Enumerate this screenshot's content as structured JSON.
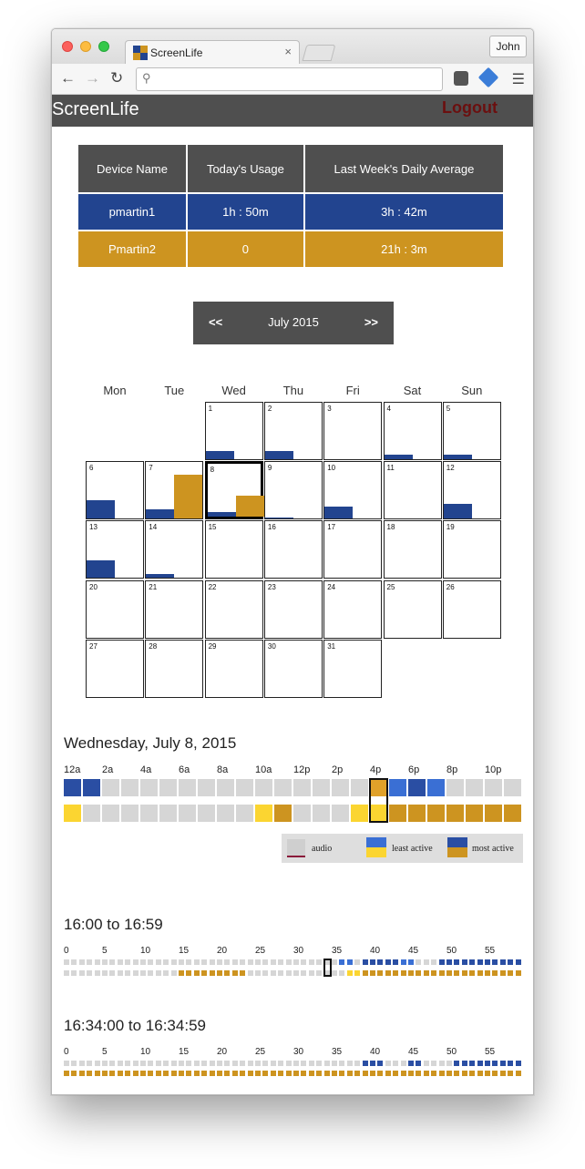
{
  "browser": {
    "tab_title": "ScreenLife",
    "tab_close": "×",
    "profile": "John",
    "address": ""
  },
  "app": {
    "brand": "ScreenLife",
    "logout": "Logout"
  },
  "devices": {
    "headers": [
      "Device Name",
      "Today's Usage",
      "Last Week's Daily Average"
    ],
    "rows": [
      {
        "name": "pmartin1",
        "today": "1h : 50m",
        "avg": "3h : 42m",
        "color": "#22448f"
      },
      {
        "name": "Pmartin2",
        "today": "0",
        "avg": "21h : 3m",
        "color": "#cd9420"
      }
    ]
  },
  "calendar": {
    "prev": "<<",
    "next": ">>",
    "month": "July 2015",
    "weekdays": [
      "Mon",
      "Tue",
      "Wed",
      "Thu",
      "Fri",
      "Sat",
      "Sun"
    ],
    "first_weekday": 2,
    "days_in_month": 31,
    "selected_day": 8,
    "usage": {
      "1": {
        "d1": 0.15,
        "d2": 0
      },
      "2": {
        "d1": 0.14,
        "d2": 0
      },
      "4": {
        "d1": 0.08,
        "d2": 0
      },
      "5": {
        "d1": 0.08,
        "d2": 0
      },
      "6": {
        "d1": 0.33,
        "d2": 0
      },
      "7": {
        "d1": 0.16,
        "d2": 0.77
      },
      "8": {
        "d1": 0.08,
        "d2": 0.37
      },
      "9": {
        "d1": 0.02,
        "d2": 0
      },
      "10": {
        "d1": 0.21,
        "d2": 0
      },
      "12": {
        "d1": 0.26,
        "d2": 0
      },
      "13": {
        "d1": 0.3,
        "d2": 0
      },
      "14": {
        "d1": 0.06,
        "d2": 0
      }
    }
  },
  "day_view": {
    "title": "Wednesday, July 8, 2015",
    "hour_labels": [
      "12a",
      "2a",
      "4a",
      "6a",
      "8a",
      "10a",
      "12p",
      "2p",
      "4p",
      "6p",
      "8p",
      "10p"
    ],
    "selected_hour": 16,
    "device1_hours": [
      "d",
      "d",
      "g",
      "g",
      "g",
      "g",
      "g",
      "g",
      "g",
      "g",
      "g",
      "g",
      "g",
      "g",
      "g",
      "g",
      "m",
      "l",
      "d",
      "l",
      "g",
      "g",
      "g",
      "g"
    ],
    "device2_hours": [
      "y",
      "g",
      "g",
      "g",
      "g",
      "g",
      "g",
      "g",
      "g",
      "g",
      "y",
      "o",
      "g",
      "g",
      "g",
      "y",
      "y",
      "o",
      "o",
      "o",
      "o",
      "o",
      "o",
      "o"
    ],
    "legend": {
      "audio": "audio",
      "least": "least active",
      "most": "most active"
    }
  },
  "hour_view": {
    "title": "16:00 to 16:59",
    "tick_labels": [
      "0",
      "5",
      "10",
      "15",
      "20",
      "25",
      "30",
      "35",
      "40",
      "45",
      "50",
      "55"
    ],
    "selected_minute": 34,
    "device1_minutes": "ggggggggggggggggggggggggggggggggggggllgdddddllgggdddddddddddddddd",
    "device2_minutes": "gggggggggggggggooooooooogggggggggggggyyoooooooooooooooooooooooooooo"
  },
  "minute_view": {
    "title": "16:34:00 to 16:34:59",
    "tick_labels": [
      "0",
      "5",
      "10",
      "15",
      "20",
      "25",
      "30",
      "35",
      "40",
      "45",
      "50",
      "55"
    ],
    "device1_seconds": "gggggggggggggggggggggggggggggggggggggggdddgggddggggddddddddddgggggggggggggggggggggg",
    "device2_seconds": "oooooooooooooooooooooooooooooooooooooooooooooooooooooooooooooo"
  },
  "colors": {
    "d": "#2a4ea3",
    "l": "#3a6fd4",
    "m": "#e0a12a",
    "g": "#d6d6d6",
    "y": "#fbd531",
    "o": "#cd9420",
    "device1": "#22448f",
    "device2": "#cd9420"
  }
}
